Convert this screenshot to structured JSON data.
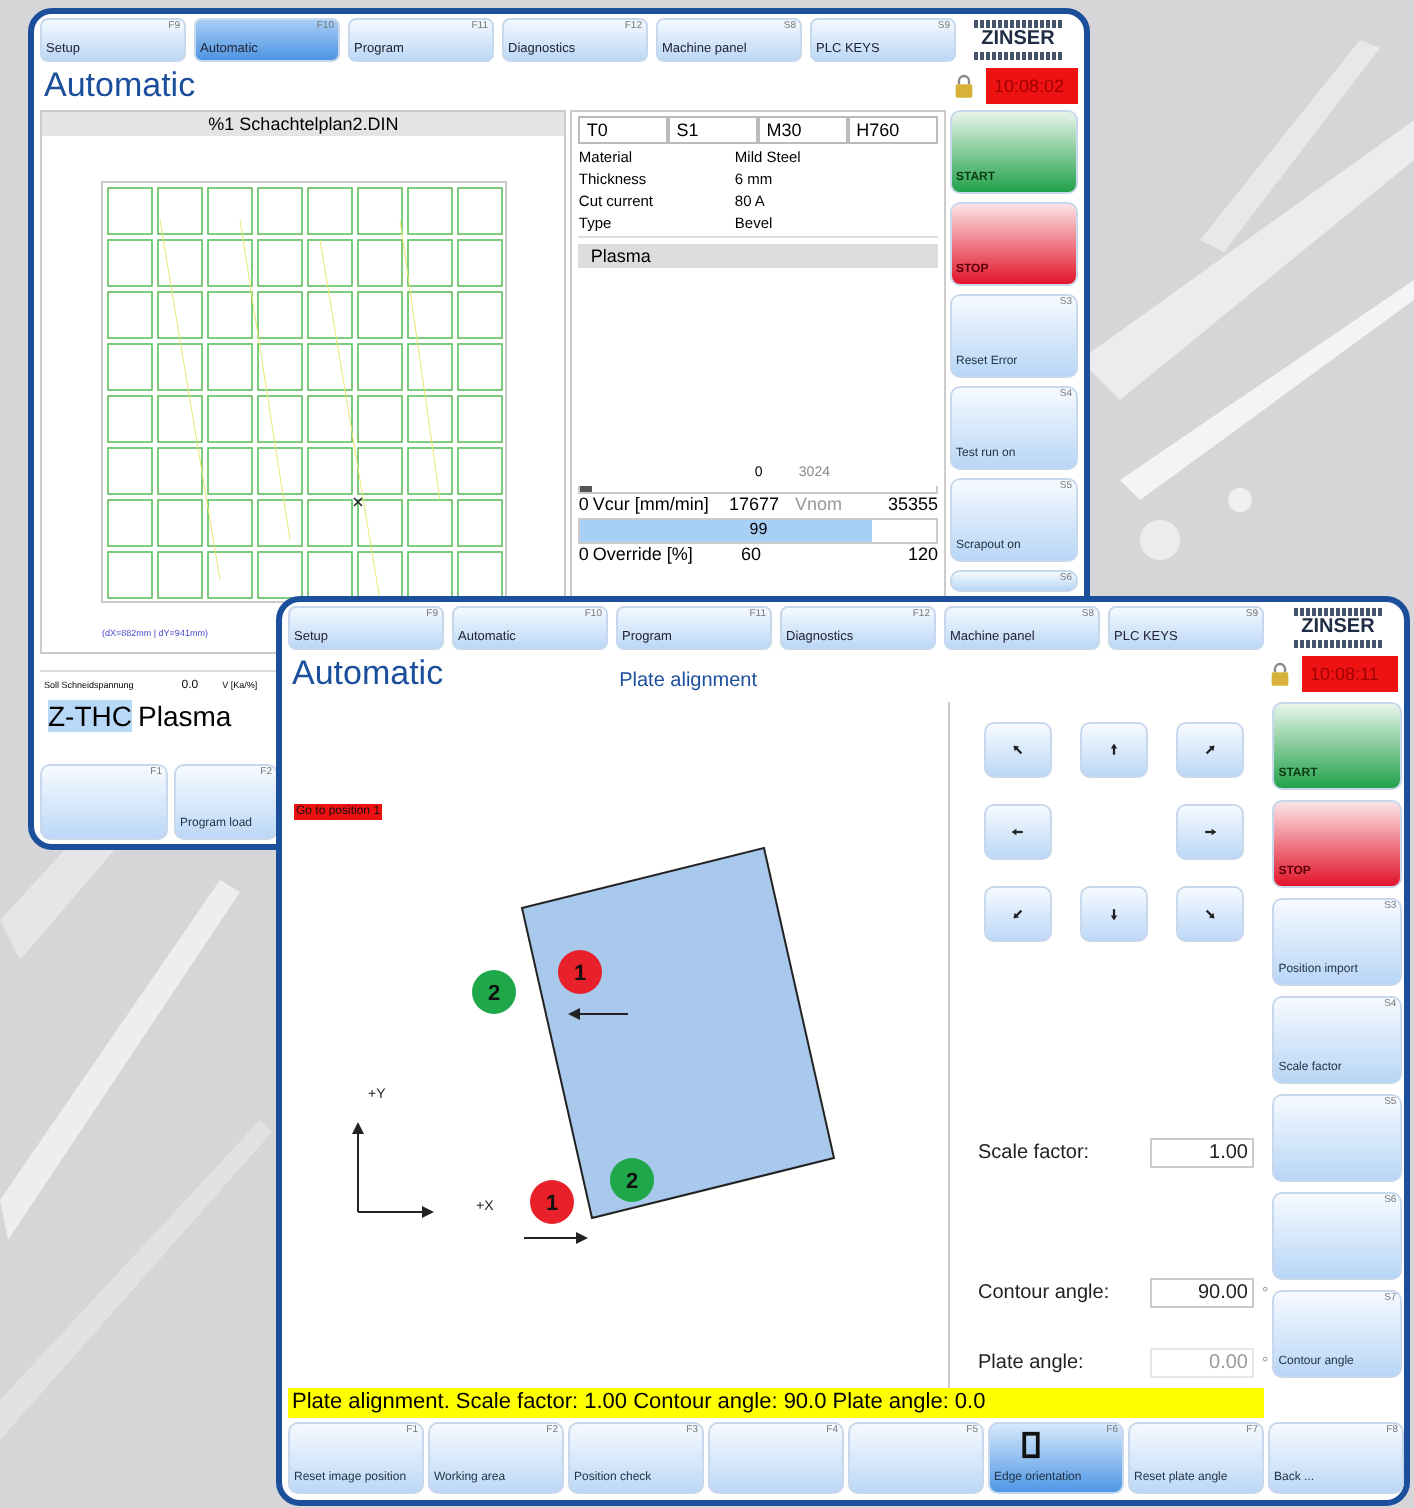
{
  "back_window": {
    "tabs": [
      {
        "label": "Setup",
        "key": "F9",
        "selected": false
      },
      {
        "label": "Automatic",
        "key": "F10",
        "selected": true
      },
      {
        "label": "Program",
        "key": "F11",
        "selected": false
      },
      {
        "label": "Diagnostics",
        "key": "F12",
        "selected": false
      },
      {
        "label": "Machine panel",
        "key": "S8",
        "selected": false
      },
      {
        "label": "PLC KEYS",
        "key": "S9",
        "selected": false
      }
    ],
    "logo": "ZINSER",
    "title": "Automatic",
    "clock": "10:08:02",
    "program": {
      "file": "%1 Schachtelplan2.DIN",
      "caption": "(dX=882mm | dY=941mm)"
    },
    "tool_fields": [
      "T0",
      "S1",
      "M30",
      "H760"
    ],
    "properties": [
      {
        "label": "Material",
        "value": "Mild Steel"
      },
      {
        "label": "Thickness",
        "value": "6 mm"
      },
      {
        "label": "Cut current",
        "value": "80 A"
      },
      {
        "label": "Type",
        "value": "Bevel"
      }
    ],
    "section": "Plasma",
    "speed": {
      "scale_low": "0",
      "scale_high": "3024",
      "level": 0.03,
      "low": "0",
      "label": "Vcur [mm/min]",
      "value": "17677",
      "nominal_label": "Vnom",
      "max": "35355"
    },
    "override": {
      "value": "99",
      "level": 0.82,
      "low": "0",
      "label": "Override [%]",
      "mid": "60",
      "max": "120"
    },
    "side_buttons": [
      {
        "kind": "start",
        "label": "START"
      },
      {
        "kind": "stop",
        "label": "STOP"
      },
      {
        "kind": "normal",
        "label": "Reset Error",
        "key": "S3"
      },
      {
        "kind": "normal",
        "label": "Test run on",
        "key": "S4"
      },
      {
        "kind": "normal",
        "label": "Scrapout on",
        "key": "S5"
      },
      {
        "kind": "normal",
        "key": "S6"
      }
    ],
    "thc": {
      "label": "Soll Schneidspannung",
      "value": "0.0",
      "unit": "V [Ka/%]"
    },
    "mode": {
      "tag": "Z-THC",
      "text": "Plasma"
    },
    "fkeys": [
      {
        "key": "F1"
      },
      {
        "key": "F2",
        "label": "Program load"
      }
    ]
  },
  "front_window": {
    "tabs": [
      {
        "label": "Setup",
        "key": "F9",
        "selected": false
      },
      {
        "label": "Automatic",
        "key": "F10",
        "selected": false
      },
      {
        "label": "Program",
        "key": "F11",
        "selected": false
      },
      {
        "label": "Diagnostics",
        "key": "F12",
        "selected": false
      },
      {
        "label": "Machine panel",
        "key": "S8",
        "selected": false
      },
      {
        "label": "PLC KEYS",
        "key": "S9",
        "selected": false
      }
    ],
    "logo": "ZINSER",
    "title": "Automatic",
    "subtitle": "Plate alignment",
    "clock": "10:08:11",
    "message": "Go to position 1",
    "axes": {
      "y": "+Y",
      "x": "+X"
    },
    "markers": [
      {
        "label": "1",
        "color": "#e8202a"
      },
      {
        "label": "2",
        "color": "#1ea84a"
      },
      {
        "label": "1",
        "color": "#e8202a"
      },
      {
        "label": "2",
        "color": "#1ea84a"
      }
    ],
    "jog": [
      {
        "kind": "nw"
      },
      {
        "kind": "n"
      },
      {
        "kind": "ne"
      },
      {
        "kind": "w"
      },
      {
        "kind": "e"
      },
      {
        "kind": "sw"
      },
      {
        "kind": "s"
      },
      {
        "kind": "se"
      }
    ],
    "fields": [
      {
        "label": "Scale factor:",
        "value": "1.00",
        "disabled": false
      },
      {
        "label": "Contour angle:",
        "value": "90.00",
        "unit": "°",
        "disabled": false
      },
      {
        "label": "Plate angle:",
        "value": "0.00",
        "unit": "°",
        "disabled": true
      }
    ],
    "side_buttons": [
      {
        "kind": "start",
        "label": "START"
      },
      {
        "kind": "stop",
        "label": "STOP"
      },
      {
        "kind": "normal",
        "label": "Position import",
        "key": "S3"
      },
      {
        "kind": "normal",
        "label": "Scale factor",
        "key": "S4"
      },
      {
        "kind": "normal",
        "key": "S5"
      },
      {
        "kind": "normal",
        "key": "S6"
      },
      {
        "kind": "normal",
        "label": "Contour angle",
        "key": "S7"
      }
    ],
    "status": "Plate alignment. Scale factor: 1.00 Contour angle: 90.0 Plate angle: 0.0",
    "fkeys": [
      {
        "kind": "text",
        "key": "F1",
        "label": "Reset image position",
        "selected": false
      },
      {
        "kind": "text",
        "key": "F2",
        "label": "Working area",
        "selected": false
      },
      {
        "kind": "text",
        "key": "F3",
        "label": "Position check",
        "selected": false
      },
      {
        "kind": "text",
        "key": "F4",
        "selected": false
      },
      {
        "kind": "text",
        "key": "F5",
        "selected": false
      },
      {
        "kind": "icon",
        "key": "F6",
        "label": "Edge orientation",
        "selected": true
      },
      {
        "kind": "text",
        "key": "F7",
        "label": "Reset plate angle",
        "selected": false
      },
      {
        "kind": "text",
        "key": "F8",
        "label": "Back ...",
        "selected": false
      }
    ]
  }
}
